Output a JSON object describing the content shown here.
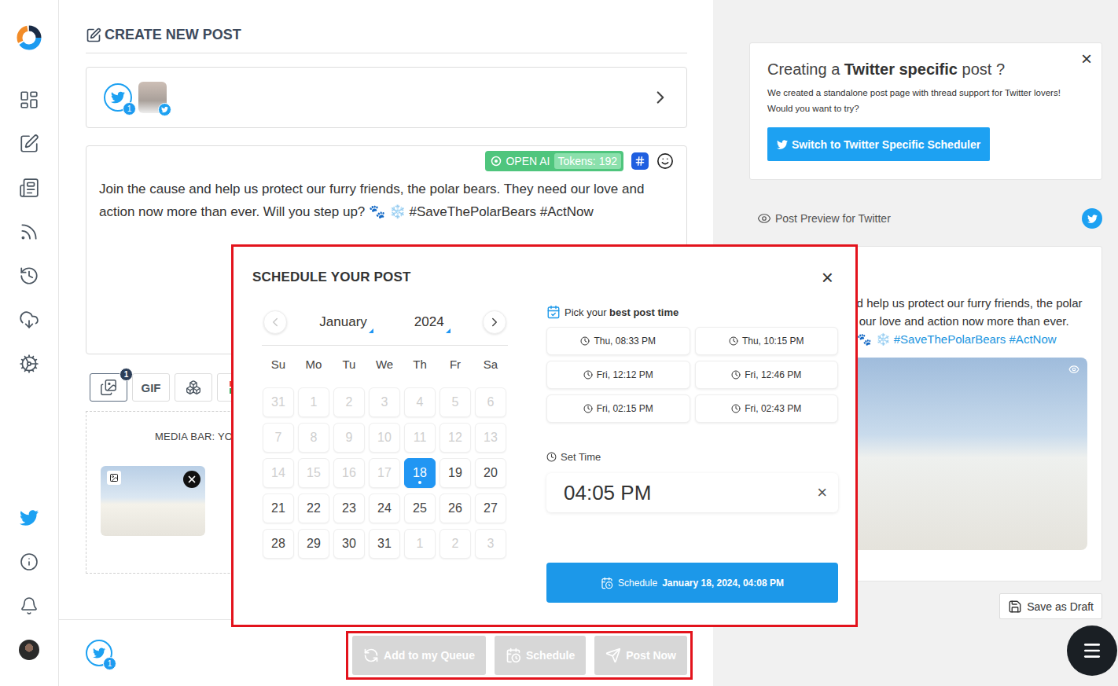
{
  "page": {
    "title": "CREATE NEW POST"
  },
  "accounts": {
    "badge": "1"
  },
  "editor": {
    "ai_label": "OPEN AI",
    "tokens": "Tokens: 192",
    "text": "Join the cause and help us protect our furry friends, the polar bears. They need our love and action now more than ever. Will you step up? 🐾 ❄️ #SaveThePolarBears #ActNow"
  },
  "media_toolbar": {
    "image_badge": "1",
    "image_selected": true,
    "gif_label": "GIF"
  },
  "media_bar": {
    "label": "MEDIA BAR: YO"
  },
  "footer": {
    "account_badge": "1",
    "buttons": [
      {
        "label": "Add to my Queue",
        "disabled": true
      },
      {
        "label": "Schedule",
        "disabled": true
      },
      {
        "label": "Post Now",
        "disabled": true
      }
    ]
  },
  "promo": {
    "title_before": "Creating a ",
    "title_bold": "Twitter specific",
    "title_after": " post ?",
    "description": "We created a standalone post page with thread support for Twitter lovers! Would you want to try?",
    "button": "Switch to Twitter Specific Scheduler",
    "close": "×"
  },
  "preview": {
    "label": "Post Preview for Twitter"
  },
  "draft_button": "Save as Draft",
  "schedule_modal": {
    "title": "SCHEDULE YOUR POST",
    "close": "×",
    "prev_disabled": true,
    "month": "January",
    "year": "2024",
    "weekdays": [
      "Su",
      "Mo",
      "Tu",
      "We",
      "Th",
      "Fr",
      "Sa"
    ],
    "days": [
      {
        "label": "31",
        "disabled": true,
        "selected": false,
        "today": false
      },
      {
        "label": "1",
        "disabled": true,
        "selected": false,
        "today": false
      },
      {
        "label": "2",
        "disabled": true,
        "selected": false,
        "today": false
      },
      {
        "label": "3",
        "disabled": true,
        "selected": false,
        "today": false
      },
      {
        "label": "4",
        "disabled": true,
        "selected": false,
        "today": false
      },
      {
        "label": "5",
        "disabled": true,
        "selected": false,
        "today": false
      },
      {
        "label": "6",
        "disabled": true,
        "selected": false,
        "today": false
      },
      {
        "label": "7",
        "disabled": true,
        "selected": false,
        "today": false
      },
      {
        "label": "8",
        "disabled": true,
        "selected": false,
        "today": false
      },
      {
        "label": "9",
        "disabled": true,
        "selected": false,
        "today": false
      },
      {
        "label": "10",
        "disabled": true,
        "selected": false,
        "today": false
      },
      {
        "label": "11",
        "disabled": true,
        "selected": false,
        "today": false
      },
      {
        "label": "12",
        "disabled": true,
        "selected": false,
        "today": false
      },
      {
        "label": "13",
        "disabled": true,
        "selected": false,
        "today": false
      },
      {
        "label": "14",
        "disabled": true,
        "selected": false,
        "today": false
      },
      {
        "label": "15",
        "disabled": true,
        "selected": false,
        "today": false
      },
      {
        "label": "16",
        "disabled": true,
        "selected": false,
        "today": false
      },
      {
        "label": "17",
        "disabled": true,
        "selected": false,
        "today": false
      },
      {
        "label": "18",
        "disabled": false,
        "selected": true,
        "today": true
      },
      {
        "label": "19",
        "disabled": false,
        "selected": false,
        "today": false
      },
      {
        "label": "20",
        "disabled": false,
        "selected": false,
        "today": false
      },
      {
        "label": "21",
        "disabled": false,
        "selected": false,
        "today": false
      },
      {
        "label": "22",
        "disabled": false,
        "selected": false,
        "today": false
      },
      {
        "label": "23",
        "disabled": false,
        "selected": false,
        "today": false
      },
      {
        "label": "24",
        "disabled": false,
        "selected": false,
        "today": false
      },
      {
        "label": "25",
        "disabled": false,
        "selected": false,
        "today": false
      },
      {
        "label": "26",
        "disabled": false,
        "selected": false,
        "today": false
      },
      {
        "label": "27",
        "disabled": false,
        "selected": false,
        "today": false
      },
      {
        "label": "28",
        "disabled": false,
        "selected": false,
        "today": false
      },
      {
        "label": "29",
        "disabled": false,
        "selected": false,
        "today": false
      },
      {
        "label": "30",
        "disabled": false,
        "selected": false,
        "today": false
      },
      {
        "label": "31",
        "disabled": false,
        "selected": false,
        "today": false
      },
      {
        "label": "1",
        "disabled": true,
        "selected": false,
        "today": false
      },
      {
        "label": "2",
        "disabled": true,
        "selected": false,
        "today": false
      },
      {
        "label": "3",
        "disabled": true,
        "selected": false,
        "today": false
      }
    ],
    "best_time_before": "Pick your ",
    "best_time_bold": "best post time",
    "best_times": [
      "Thu, 08:33 PM",
      "Thu, 10:15 PM",
      "Fri, 12:12 PM",
      "Fri, 12:46 PM",
      "Fri, 02:15 PM",
      "Fri, 02:43 PM"
    ],
    "set_time_label": "Set Time",
    "time_value": "04:05 PM",
    "clear": "×",
    "schedule_label": "Schedule",
    "schedule_datetime": "January 18, 2024, 04:08 PM"
  }
}
